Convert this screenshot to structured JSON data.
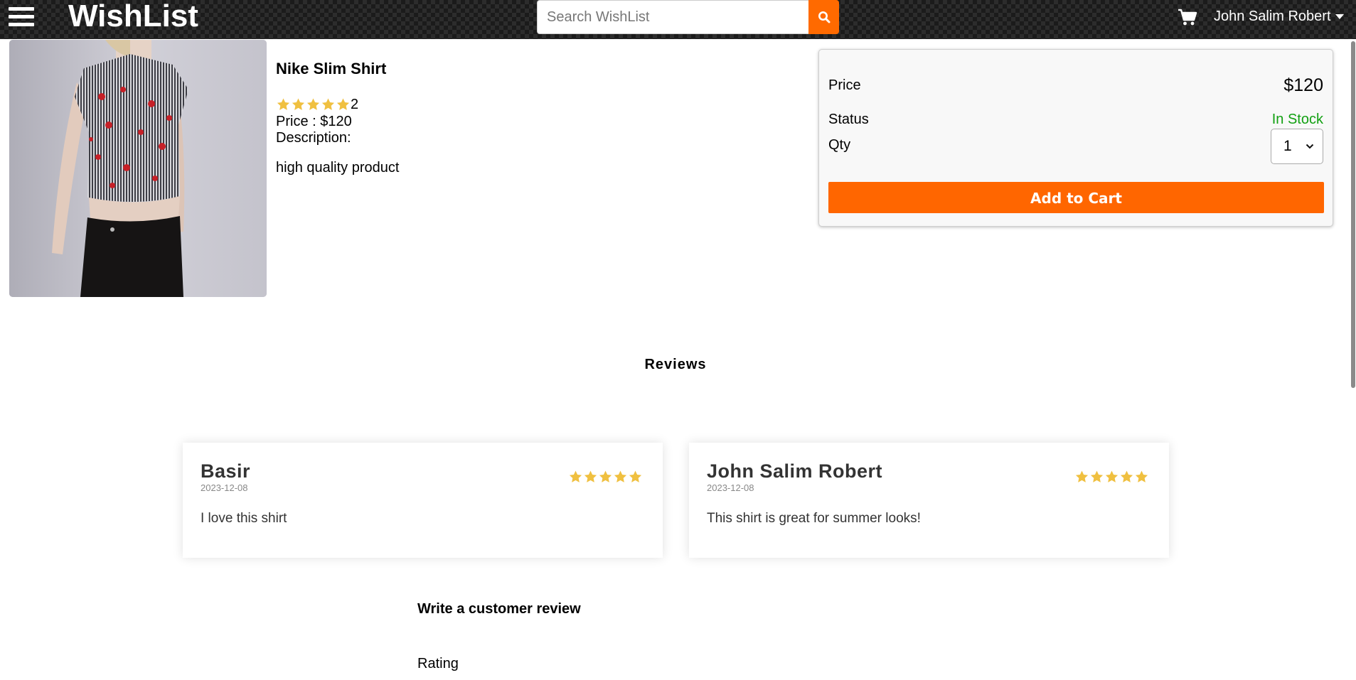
{
  "header": {
    "brand": "WishList",
    "search_placeholder": "Search WishList",
    "user_name": "John Salim Robert"
  },
  "product": {
    "name": "Nike Slim Shirt",
    "rating": 5,
    "num_reviews": "2",
    "price_text": "Price : $120",
    "description_label": "Description:",
    "description": "high quality product"
  },
  "buy_box": {
    "price_label": "Price",
    "price_value": "$120",
    "status_label": "Status",
    "status_value": "In Stock",
    "qty_label": "Qty",
    "qty_value": "1",
    "add_to_cart_label": "Add to Cart"
  },
  "reviews": {
    "title": "Reviews",
    "items": [
      {
        "name": "Basir",
        "date": "2023-12-08",
        "rating": 5,
        "comment": "I love this shirt"
      },
      {
        "name": "John Salim Robert",
        "date": "2023-12-08",
        "rating": 5,
        "comment": "This shirt is great for summer looks!"
      }
    ],
    "write_title": "Write a customer review",
    "rating_label": "Rating"
  },
  "colors": {
    "accent": "#ff6600",
    "in_stock": "#12a012",
    "star": "#f0c040"
  },
  "icons": {
    "menu": "hamburger-menu-icon",
    "search": "search-icon",
    "cart": "shopping-cart-icon",
    "caret": "caret-down-icon",
    "star": "star-icon",
    "chevron": "chevron-down-icon"
  }
}
